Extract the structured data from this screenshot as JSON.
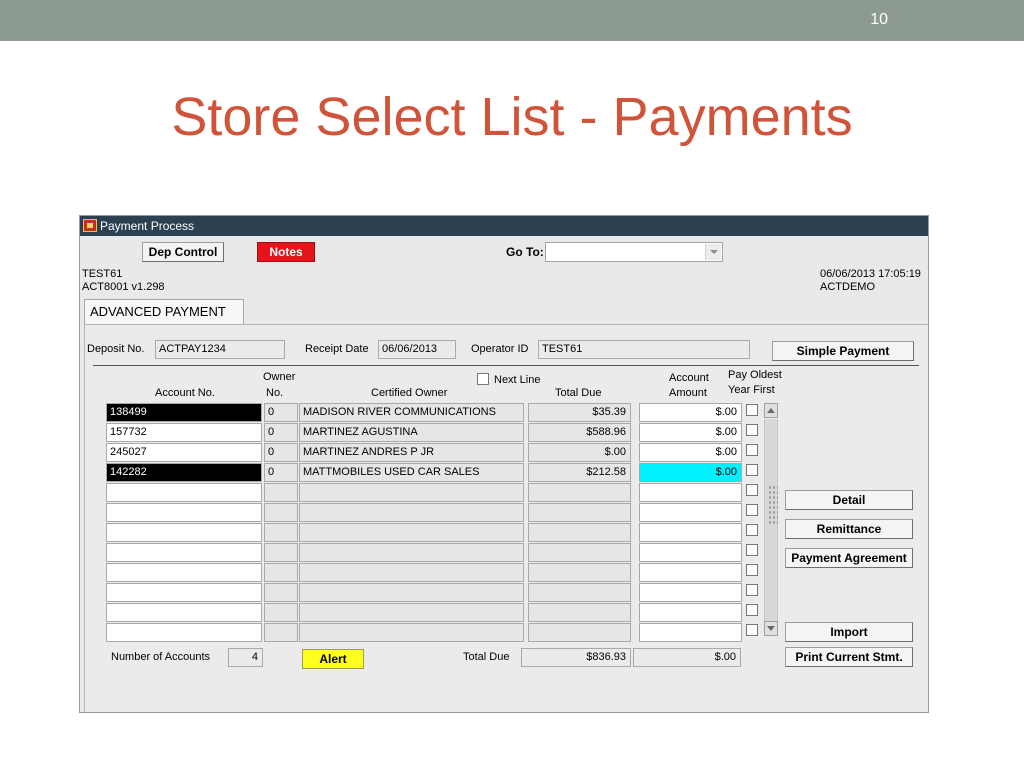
{
  "slide": {
    "number": "10",
    "title": "Store Select List - Payments"
  },
  "window": {
    "title": "Payment Process"
  },
  "toolbar": {
    "dep_control": "Dep Control",
    "notes": "Notes",
    "goto_label": "Go To:",
    "goto_value": ""
  },
  "header": {
    "left_line1": "TEST61",
    "left_line2": "ACT8001   v1.298",
    "right_line1": "06/06/2013 17:05:19",
    "right_line2": "ACTDEMO"
  },
  "tab": {
    "label": "ADVANCED PAYMENT"
  },
  "form": {
    "deposit_label": "Deposit No.",
    "deposit_value": "ACTPAY1234",
    "receipt_label": "Receipt Date",
    "receipt_value": "06/06/2013",
    "operator_label": "Operator ID",
    "operator_value": "TEST61",
    "simple_payment": "Simple Payment"
  },
  "columns": {
    "owner_line1": "Owner",
    "owner_line2": "No.",
    "account_no": "Account No.",
    "certified_owner": "Certified Owner",
    "next_line": "Next Line",
    "total_due": "Total Due",
    "account_amount_line1": "Account",
    "account_amount_line2": "Amount",
    "pay_oldest_line1": "Pay Oldest",
    "pay_oldest_line2": "Year First"
  },
  "rows": [
    {
      "account": "138499",
      "owner_no": "0",
      "owner": "MADISON RIVER COMMUNICATIONS",
      "total_due": "$35.39",
      "amount": "$.00",
      "pay_oldest": false
    },
    {
      "account": "157732",
      "owner_no": "0",
      "owner": "MARTINEZ AGUSTINA",
      "total_due": "$588.96",
      "amount": "$.00",
      "pay_oldest": false
    },
    {
      "account": "245027",
      "owner_no": "0",
      "owner": "MARTINEZ ANDRES P JR",
      "total_due": "$.00",
      "amount": "$.00",
      "pay_oldest": false
    },
    {
      "account": "142282",
      "owner_no": "0",
      "owner": "MATTMOBILES USED CAR SALES",
      "total_due": "$212.58",
      "amount": "$.00",
      "pay_oldest": false
    },
    {
      "account": "",
      "owner_no": "",
      "owner": "",
      "total_due": "",
      "amount": "",
      "pay_oldest": false
    },
    {
      "account": "",
      "owner_no": "",
      "owner": "",
      "total_due": "",
      "amount": "",
      "pay_oldest": false
    },
    {
      "account": "",
      "owner_no": "",
      "owner": "",
      "total_due": "",
      "amount": "",
      "pay_oldest": false
    },
    {
      "account": "",
      "owner_no": "",
      "owner": "",
      "total_due": "",
      "amount": "",
      "pay_oldest": false
    },
    {
      "account": "",
      "owner_no": "",
      "owner": "",
      "total_due": "",
      "amount": "",
      "pay_oldest": false
    },
    {
      "account": "",
      "owner_no": "",
      "owner": "",
      "total_due": "",
      "amount": "",
      "pay_oldest": false
    },
    {
      "account": "",
      "owner_no": "",
      "owner": "",
      "total_due": "",
      "amount": "",
      "pay_oldest": false
    },
    {
      "account": "",
      "owner_no": "",
      "owner": "",
      "total_due": "",
      "amount": "",
      "pay_oldest": false
    }
  ],
  "side_buttons": {
    "detail": "Detail",
    "remittance": "Remittance",
    "payment_agreement": "Payment Agreement",
    "import": "Import",
    "print_current": "Print Current Stmt."
  },
  "footer": {
    "num_accounts_label": "Number of Accounts",
    "num_accounts_value": "4",
    "alert": "Alert",
    "total_due_label": "Total Due",
    "total_due_value": "$836.93",
    "total_amount_value": "$.00"
  },
  "colors": {
    "title": "#d0543a",
    "topbar": "#8c9a92",
    "titlebar": "#2b4051",
    "notes": "#e8121b",
    "alert": "#ffff1e",
    "selected_amount": "#00f0ff"
  }
}
